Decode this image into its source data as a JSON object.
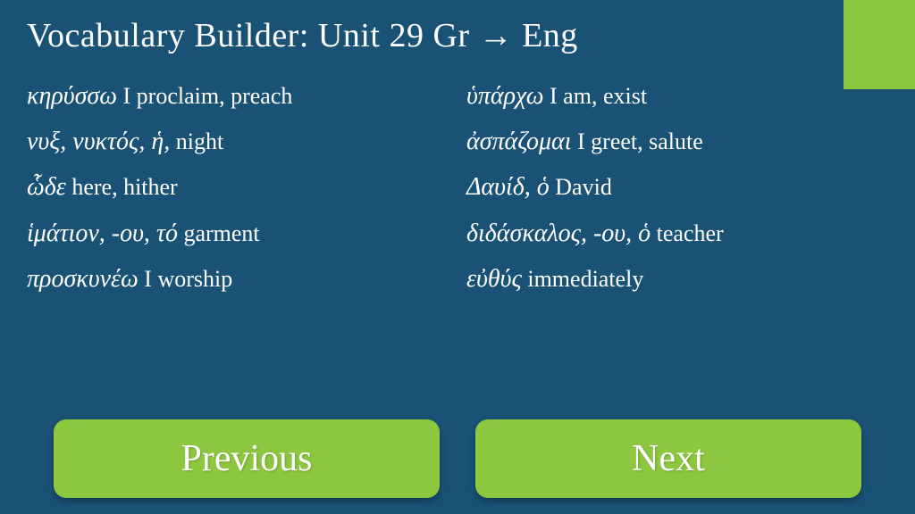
{
  "title": {
    "text": "Vocabulary Builder:  Unit 29    Gr → Eng",
    "prefix": "Vocabulary Builder:  Unit 29    Gr ",
    "arrow": "→",
    "suffix": " Eng"
  },
  "vocab": {
    "left": [
      {
        "greek": "κηρύσσω",
        "english": " I proclaim, preach"
      },
      {
        "greek": "νυξ,  νυκτός, ἡ,",
        "english": " night"
      },
      {
        "greek": "ὧδε",
        "english": "  here, hither"
      },
      {
        "greek": "ἱμάτιον, -ου, τό",
        "english": "  garment"
      },
      {
        "greek": "προσκυνέω",
        "english": "   I worship"
      }
    ],
    "right": [
      {
        "greek": "ὑπάρχω",
        "english": " I am, exist"
      },
      {
        "greek": "ἀσπάζομαι",
        "english": "  I greet, salute"
      },
      {
        "greek": "Δαυίδ, ὁ",
        "english": "  David"
      },
      {
        "greek": "διδάσκαλος,  -ου,  ὁ",
        "english": "  teacher"
      },
      {
        "greek": "εὐθύς",
        "english": "   immediately"
      }
    ]
  },
  "buttons": {
    "previous": "Previous",
    "next": "Next"
  },
  "colors": {
    "background": "#1a5276",
    "accent_green": "#8dc63f",
    "text": "#ffffff"
  }
}
